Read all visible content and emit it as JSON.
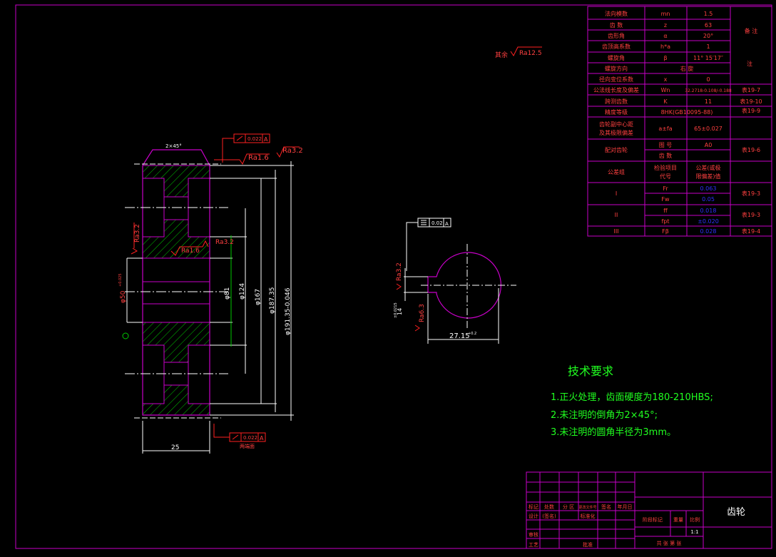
{
  "colors": {
    "background": "#000000",
    "frame": "#c800c8",
    "outline": "#ffffff",
    "dimension": "#ffffff",
    "hatch": "#00c800",
    "center": "#ffffff",
    "roughness": "#ff2020",
    "table_text": "#ff4040",
    "table_blue": "#3030ff",
    "tech_text": "#20ff20",
    "title_text": "#ffffff"
  },
  "params": {
    "rows": [
      {
        "name": "法向模数",
        "sym": "mn",
        "val": "1.5"
      },
      {
        "name": "齿 数",
        "sym": "z",
        "val": "63"
      },
      {
        "name": "齿形角",
        "sym": "α",
        "val": "20°"
      },
      {
        "name": "齿顶高系数",
        "sym": "h*a",
        "val": "1"
      },
      {
        "name": "螺旋角",
        "sym": "β",
        "val": "11° 15′17″"
      },
      {
        "name": "螺旋方向",
        "sym": "",
        "val": "右  旋"
      },
      {
        "name": "径向变位系数",
        "sym": "x",
        "val": "0"
      },
      {
        "name": "公法线长度及偏差",
        "sym": "Wn",
        "val": "32.2718-0.108/-0.188"
      },
      {
        "name": "跨测齿数",
        "sym": "K",
        "val": "11"
      },
      {
        "name": "精度等级",
        "sym": "",
        "val": "8HK(GB10095-88)"
      }
    ],
    "note_header": "备\n注",
    "note_side": "注",
    "notes": [
      "表19-7",
      "表19-10",
      "表19-9",
      "表19-6",
      "表19-3",
      "表19-3",
      "表19-4"
    ],
    "center_dist": {
      "name1": "齿轮副中心距",
      "name2": "及其极限偏差",
      "sym": "a±fa",
      "val": "65±0.027"
    },
    "mating": {
      "name": "配对齿轮",
      "r1_label": "图 号",
      "r1_val": "A0",
      "r2_label": "齿 数"
    },
    "tolerance": {
      "name": "公差组",
      "h1": "检验项目",
      "h1b": "代号",
      "h2": "公差(或极",
      "h2b": "限偏差)值"
    },
    "groups": [
      {
        "group": "I",
        "items": [
          {
            "code": "Fr",
            "val": "0.063"
          },
          {
            "code": "Fw",
            "val": "0.05"
          }
        ]
      },
      {
        "group": "II",
        "items": [
          {
            "code": "ff",
            "val": "0.018"
          },
          {
            "code": "fpt",
            "val": "±0.020"
          }
        ]
      },
      {
        "group": "III",
        "items": [
          {
            "code": "Fβ",
            "val": "0.028"
          }
        ]
      }
    ]
  },
  "drawing": {
    "rest_label": "其余",
    "rest_ra": "Ra12.5",
    "chamfer": "2×45°",
    "tol_runout_top": "0.022",
    "tol_runout_bottom": "0.022",
    "datum": "A",
    "ra_top1": "Ra1.6",
    "ra_top2": "Ra3.2",
    "ra_left": "Ra3.2",
    "ra_inner1": "Ra1.6",
    "ra_inner2": "Ra3.2",
    "dim_width": "25",
    "dim_bore": "φ50",
    "dim_bore_tol": "+0.025",
    "dim_81": "φ81",
    "dim_124": "φ124",
    "dim_167": "φ167",
    "dim_187": "φ187.35",
    "dim_191": "φ191.35-0.046",
    "bottom_label": "两端面",
    "keyway_tol": "0.02",
    "keyway_ra1": "Ra3.2",
    "keyway_ra2": "Ra6.3",
    "keyway_width": "14",
    "keyway_width_tol": "±0.0215",
    "keyway_depth": "27.15",
    "keyway_depth_tol": "+0.2"
  },
  "tech": {
    "title": "技术要求",
    "items": [
      "1.正火处理，齿面硬度为180-210HBS;",
      "2.未注明的倒角为2×45°;",
      "3.未注明的圆角半径为3mm。"
    ]
  },
  "title_block": {
    "part_name": "齿轮",
    "labels": [
      "标记",
      "处数",
      "分 区",
      "更改文件号",
      "签名",
      "年月日"
    ],
    "row2": [
      "设计",
      "(签名)",
      "",
      "标准化",
      "",
      ""
    ],
    "row3": "审核",
    "row4": "工艺",
    "row4b": "批准",
    "stage": "阶段标记",
    "weight": "重量",
    "scale_label": "比例",
    "scale": "1:1",
    "sheets": "共 张  第 张"
  }
}
